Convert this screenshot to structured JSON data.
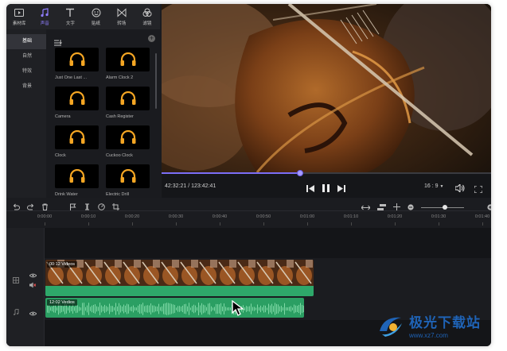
{
  "toolbar": {
    "tabs": [
      {
        "label": "素材库",
        "icon": "media-library-icon"
      },
      {
        "label": "声音",
        "icon": "music-note-icon",
        "active": true
      },
      {
        "label": "文字",
        "icon": "text-icon"
      },
      {
        "label": "贴纸",
        "icon": "sticker-icon"
      },
      {
        "label": "转场",
        "icon": "transition-icon"
      },
      {
        "label": "滤镜",
        "icon": "filter-icon"
      }
    ],
    "active_color": "#8f7dff"
  },
  "categories": [
    {
      "label": "基础",
      "active": true
    },
    {
      "label": "自然"
    },
    {
      "label": "特效"
    },
    {
      "label": "背景"
    }
  ],
  "media_items": [
    {
      "label": "Just One Last ...",
      "icon": "headphones-icon"
    },
    {
      "label": "Alarm Clock 2",
      "icon": "headphones-icon"
    },
    {
      "label": "Camera",
      "icon": "headphones-icon"
    },
    {
      "label": "Cash Register",
      "icon": "headphones-icon"
    },
    {
      "label": "Clock",
      "icon": "headphones-icon"
    },
    {
      "label": "Cuckoo Clock",
      "icon": "headphones-icon"
    },
    {
      "label": "Drink Water",
      "icon": "headphones-icon"
    },
    {
      "label": "Electric Drill",
      "icon": "headphones-icon"
    }
  ],
  "headphone_color": "#f5a623",
  "preview": {
    "time": "42:32:21 / 123:42:41",
    "progress": 0.42,
    "aspect_ratio": "16 : 9",
    "progress_color": "#7b6ef6"
  },
  "timeline": {
    "ticks": [
      "0:00:00",
      "0:00:10",
      "0:00:20",
      "0:00:30",
      "0:00:40",
      "0:00:50",
      "0:01:00",
      "0:01:10",
      "0:01:20",
      "0:01:30",
      "0:01:40"
    ],
    "video_clip": {
      "label": "00:12  Videos"
    },
    "audio_clip": {
      "label": "12:02  Vedios"
    },
    "clip_color": "#2ea86a"
  },
  "watermark": {
    "title": "极光下载站",
    "url": "www.xz7.com"
  }
}
